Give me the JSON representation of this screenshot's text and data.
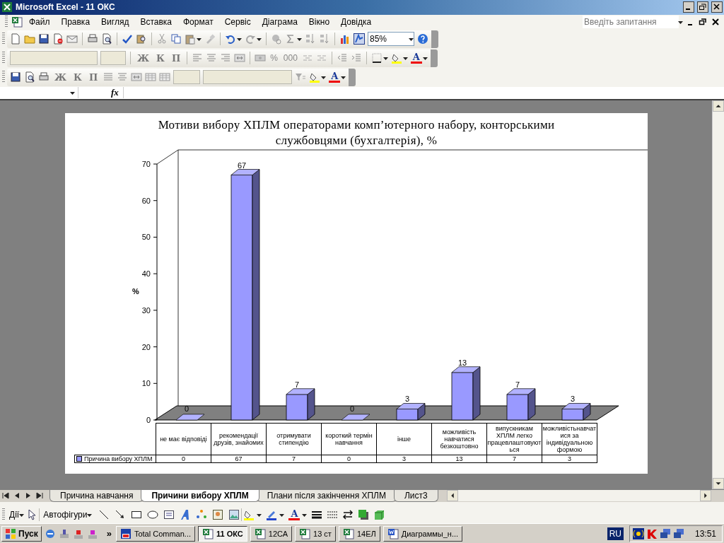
{
  "window": {
    "title": "Microsoft Excel - 11 ОКС"
  },
  "menu": [
    "Файл",
    "Правка",
    "Вигляд",
    "Вставка",
    "Формат",
    "Сервіс",
    "Діаграма",
    "Вікно",
    "Довідка"
  ],
  "help_box": {
    "placeholder": "Введіть запитання"
  },
  "standard_toolbar": {
    "zoom": "85%"
  },
  "formatting_toolbar": {
    "buttons": [
      "Ж",
      "К",
      "П"
    ],
    "percent": "%",
    "thousands": "000",
    "font_color": "A"
  },
  "chart_toolbar": {
    "buttons": [
      "Ж",
      "К",
      "П"
    ],
    "font_color": "A"
  },
  "formula_bar": {
    "function_label": "fx"
  },
  "chart": {
    "title": "Мотиви вибору ХПЛМ  операторами комп’ютерного набору, конторськими службовцями (бухгалтерія), %",
    "chart_data": {
      "type": "bar",
      "ylabel": "%",
      "categories": [
        "не має відповіді",
        "рекомендації друзів, знайомих",
        "отримувати стипендію",
        "короткий термін навчання",
        "інше",
        "можливість навчатися безкоштовно",
        "випускникам ХПЛМ легко працевлаштовуються",
        "можливістьнавчатися за індивідуальною формою"
      ],
      "series": [
        {
          "name": "Причина вибору ХПЛМ",
          "color": "#9999ff",
          "values": [
            0,
            67,
            7,
            0,
            3,
            13,
            7,
            3
          ]
        }
      ],
      "ylim": [
        0,
        70
      ],
      "yticks": [
        0,
        10,
        20,
        30,
        40,
        50,
        60,
        70
      ],
      "value_labels": [
        "0",
        "67",
        "7",
        "0",
        "3",
        "13",
        "7",
        "3"
      ]
    },
    "data_table_values": [
      "0",
      "67",
      "7",
      "0",
      "3",
      "13",
      "7",
      "3"
    ]
  },
  "sheet_tabs": [
    {
      "label": "Причина навчання",
      "selected": false
    },
    {
      "label": "Причини вибору ХПЛМ",
      "selected": true
    },
    {
      "label": "Плани після закінчення ХПЛМ",
      "selected": false
    },
    {
      "label": "Лист3",
      "selected": false
    }
  ],
  "drawing_toolbar": {
    "actions": "Дії",
    "autoshapes": "Автофігури",
    "font_color": "A"
  },
  "taskbar": {
    "start": "Пуск",
    "more": "»",
    "language": "RU",
    "clock": "13:51",
    "tasks": [
      {
        "label": "Total Comman...",
        "kind": "commander",
        "selected": false
      },
      {
        "label": "11 ОКС",
        "kind": "excel",
        "selected": true
      },
      {
        "label": "12СА",
        "kind": "excel",
        "selected": false
      },
      {
        "label": "13 ст",
        "kind": "excel",
        "selected": false
      },
      {
        "label": "14ЕЛ",
        "kind": "excel",
        "selected": false
      },
      {
        "label": "Диаграммы_н...",
        "kind": "word",
        "selected": false
      }
    ]
  }
}
